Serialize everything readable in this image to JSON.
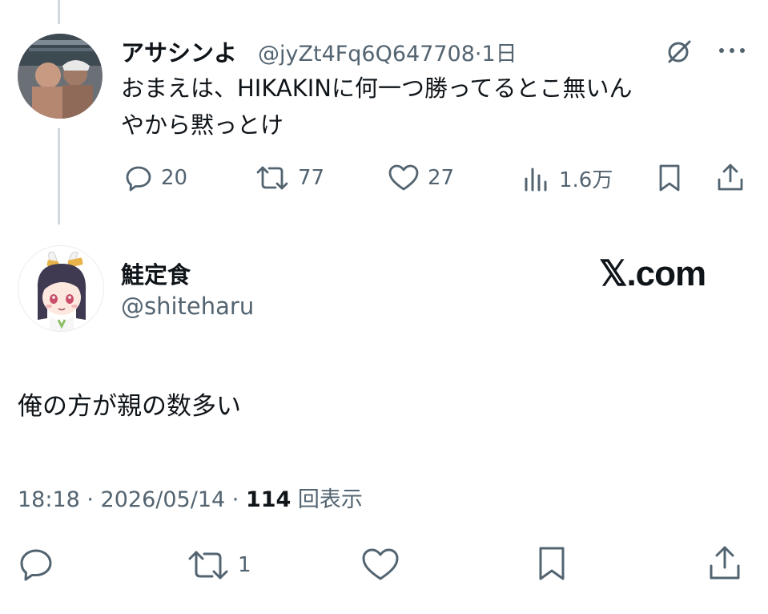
{
  "reply": {
    "display_name": "アサシンよ",
    "handle_time": "@jyZt4Fq6Q647708·1日",
    "text_line1": "おまえは、HIKAKINに何一つ勝ってるとこ無いん",
    "text_line2": "やから黙っとけ",
    "actions": {
      "replies": "20",
      "reposts": "77",
      "likes": "27",
      "views": "1.6万"
    }
  },
  "main_post": {
    "display_name": "鮭定食",
    "handle": "@shiteharu",
    "watermark": "𝕏.com",
    "text": "俺の方が親の数多い",
    "timestamp": "18:18 · 2026/05/14 · ",
    "views_count": "114",
    "views_label": " 回表示",
    "actions": {
      "reposts": "1"
    }
  },
  "icons": [
    "grok-icon",
    "more-icon",
    "reply-icon",
    "repost-icon",
    "like-icon",
    "views-icon",
    "bookmark-icon",
    "share-icon"
  ],
  "colors": {
    "text": "#0f1419",
    "muted": "#536471",
    "thread_line": "#cfd9de"
  }
}
